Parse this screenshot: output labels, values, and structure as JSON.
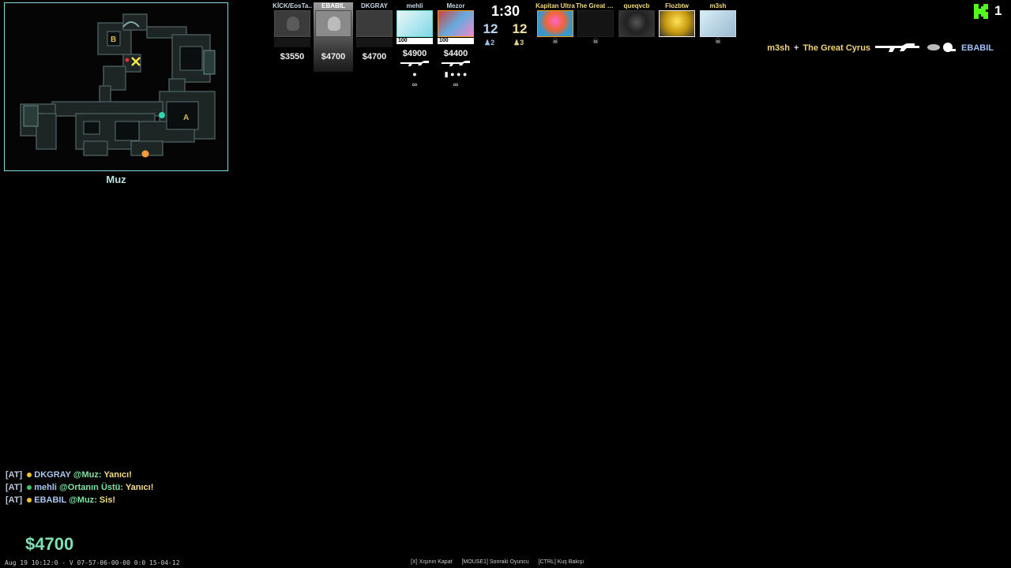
{
  "minimap": {
    "site_b": "B",
    "site_a": "A",
    "location": "Muz",
    "colors": {
      "border": "#7fe0e0",
      "walls": "#3b4a4a",
      "floor": "#1c2222",
      "bomb_marker": "#f3e84a",
      "teammate": "#2fd6b0",
      "self": "#ff9a3c"
    }
  },
  "scoreboard": {
    "timer": "1:30",
    "score_ct": "12",
    "score_t": "12",
    "alive_ct": "♟2",
    "alive_t": "♟3",
    "ct_players": [
      {
        "name": "KİCK/EosTa..",
        "portrait": "dead-icon",
        "money": "$3550"
      },
      {
        "name": "EBABIL",
        "portrait": "skull-icon",
        "money": "$4700",
        "spectated": true
      },
      {
        "name": "DKGRAY",
        "portrait": "dead-icon",
        "money": "$4700"
      },
      {
        "name": "mehli",
        "portrait": "unagi-avatar",
        "hp": "100",
        "money": "$4900",
        "weapon": "rifle-icon",
        "utility": "●",
        "defuse": "∞"
      },
      {
        "name": "Mezor",
        "portrait": "face-avatar",
        "hp": "100",
        "money": "$4400",
        "weapon": "rifle-icon",
        "utility": "▮ ● ● ●",
        "defuse": "∞"
      }
    ],
    "t_players": [
      {
        "name": "Kapitan Ultra",
        "portrait": "goku-avatar"
      },
      {
        "name": "The Great C...",
        "portrait": "dark-avatar"
      },
      {
        "name": "queqvcb",
        "portrait": "person-avatar"
      },
      {
        "name": "Flozbtw",
        "portrait": "anime-avatar"
      },
      {
        "name": "m3sh",
        "portrait": "sketch-avatar"
      }
    ],
    "skull": "☠"
  },
  "killfeed": {
    "attacker": "m3sh",
    "plus": "+",
    "assister": "The Great Cyrus",
    "weapon": "ak47-icon",
    "extra": "blind-headshot-icon",
    "victim": "EBABIL"
  },
  "top_right": {
    "logo": "kick-logo-icon",
    "count": "1"
  },
  "chat": [
    {
      "team": "[AT]",
      "name": "DKGRAY",
      "at": "@",
      "place": "Muz",
      "colon": ":",
      "msg": "Yanıcı!",
      "dot_color": "#f1c232"
    },
    {
      "team": "[AT]",
      "name": "mehli",
      "at": "@",
      "place": "Ortanın Üstü",
      "colon": ":",
      "msg": "Yanıcı!",
      "dot_color": "#3fc46a"
    },
    {
      "team": "[AT]",
      "name": "EBABIL",
      "at": "@",
      "place": "Muz",
      "colon": ":",
      "msg": "Sis!",
      "dot_color": "#f1c232"
    }
  ],
  "player_money": "$4700",
  "bottom_info": "Aug 19 10:12:0 - V 07-57-06-00-00 0:0 15-04-12",
  "hints": [
    "[X] Xışının Kapat",
    "[MOUSE1] Sonraki Oyuncu",
    "[CTRL] Kuş Bakışı"
  ]
}
